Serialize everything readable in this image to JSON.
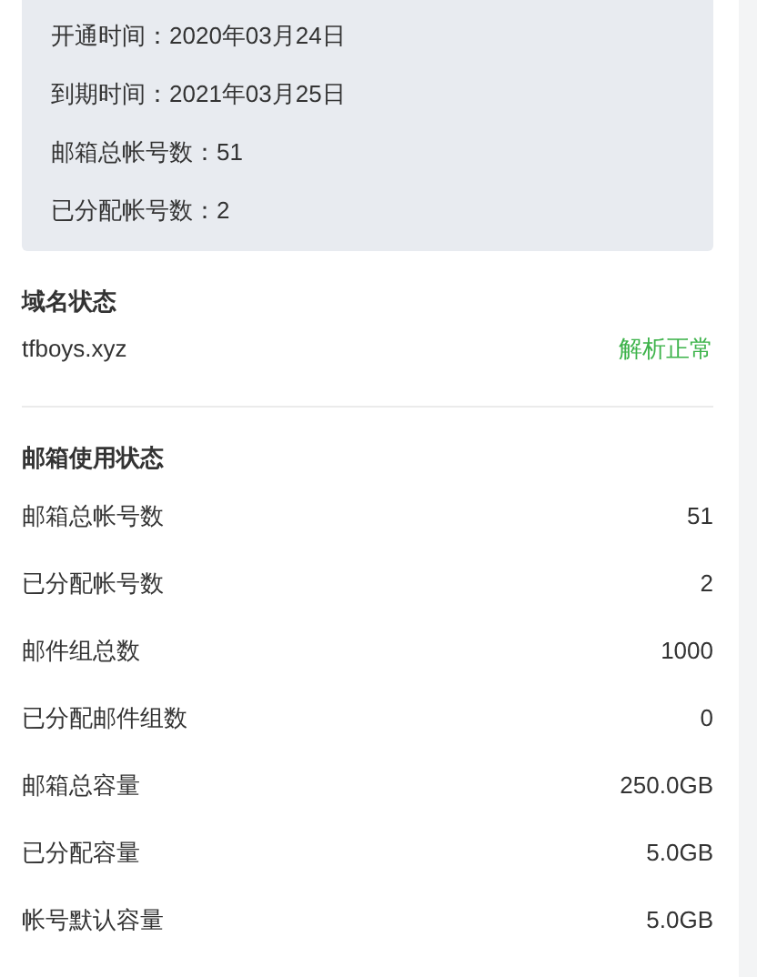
{
  "summary": [
    {
      "label": "开通时间：",
      "value": "2020年03月24日"
    },
    {
      "label": "到期时间：",
      "value": "2021年03月25日"
    },
    {
      "label": "邮箱总帐号数：",
      "value": "51"
    },
    {
      "label": "已分配帐号数：",
      "value": "2"
    }
  ],
  "domain_section": {
    "title": "域名状态",
    "domain": "tfboys.xyz",
    "status": "解析正常",
    "status_ok": true
  },
  "usage_section": {
    "title": "邮箱使用状态",
    "rows": [
      {
        "label": "邮箱总帐号数",
        "value": "51"
      },
      {
        "label": "已分配帐号数",
        "value": "2"
      },
      {
        "label": "邮件组总数",
        "value": "1000"
      },
      {
        "label": "已分配邮件组数",
        "value": "0"
      },
      {
        "label": "邮箱总容量",
        "value": "250.0GB"
      },
      {
        "label": "已分配容量",
        "value": "5.0GB"
      },
      {
        "label": "帐号默认容量",
        "value": "5.0GB"
      }
    ]
  }
}
